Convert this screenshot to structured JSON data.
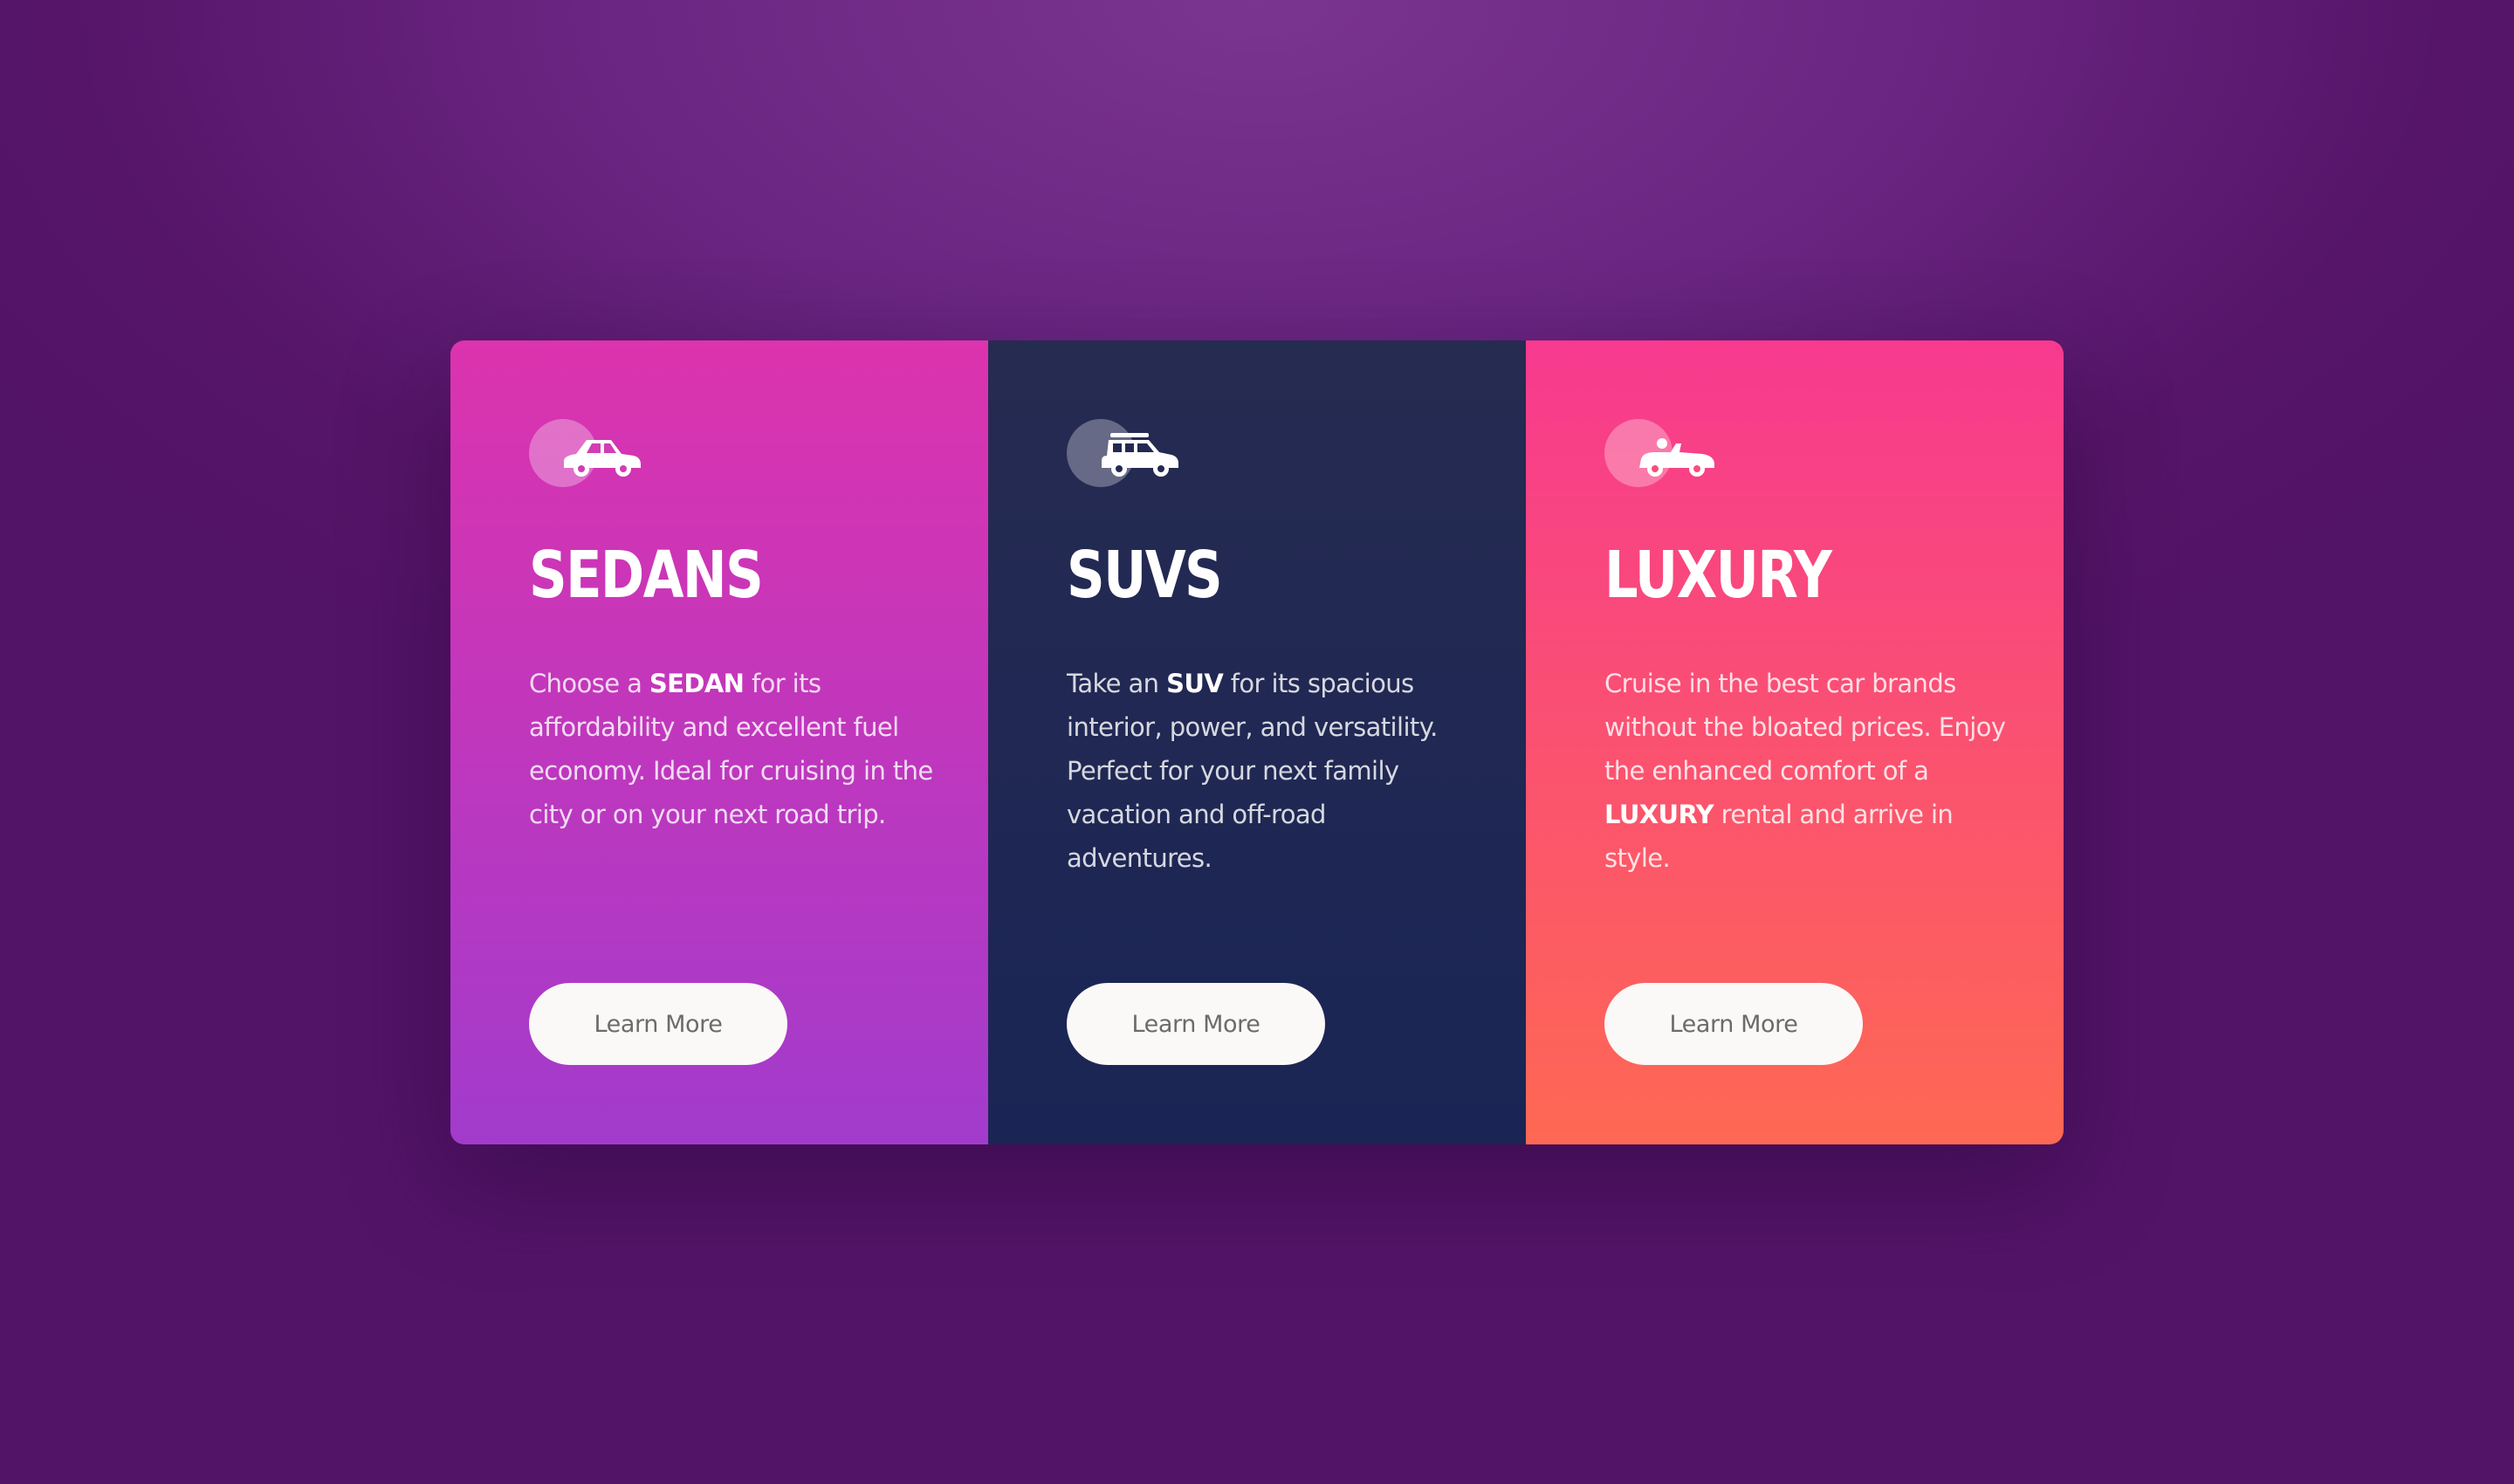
{
  "cards": [
    {
      "icon": "sedan-car-icon",
      "title": "SEDANS",
      "desc_pre": "Choose a ",
      "desc_bold": "SEDAN",
      "desc_post": " for its affordability and excellent fuel economy. Ideal for cruising in the city or on your next road trip.",
      "button_label": "Learn More",
      "gradient": [
        "#dc33ae",
        "#a23bcc"
      ]
    },
    {
      "icon": "suv-car-icon",
      "title": "SUVS",
      "desc_pre": "Take an ",
      "desc_bold": "SUV",
      "desc_post": " for its spacious interior, power, and versatility. Perfect for your next family vacation and off-road adventures.",
      "button_label": "Learn More",
      "gradient": [
        "#262b51",
        "#1a2555"
      ]
    },
    {
      "icon": "convertible-car-icon",
      "title": "LUXURY",
      "desc_pre": "Cruise in the best car brands without the bloated prices. Enjoy the enhanced comfort of a ",
      "desc_bold": "LUXURY",
      "desc_post": " rental and arrive in style.",
      "button_label": "Learn More",
      "gradient": [
        "#f73a8f",
        "#fe6853"
      ]
    }
  ],
  "colors": {
    "background": "#6a2582",
    "button_bg": "#fbf8f8",
    "button_text": "#6b6b6b"
  }
}
